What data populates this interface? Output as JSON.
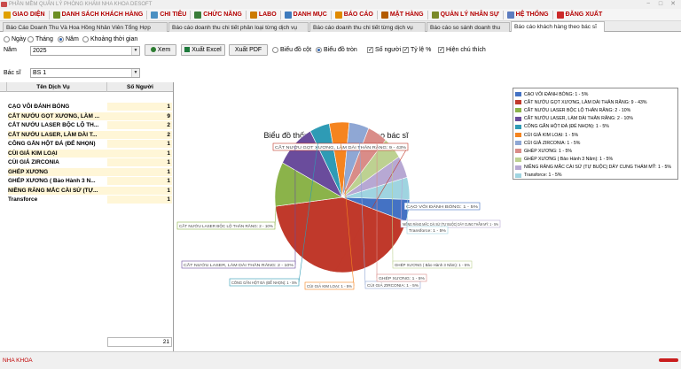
{
  "window": {
    "title": "PHẦN MỀM QUẢN LÝ PHÒNG KHÁM NHA KHOA DESOFT",
    "controls": [
      "−",
      "□",
      "✕"
    ]
  },
  "menu": [
    {
      "label": "GIAO DIỆN",
      "icon": "home-icon",
      "color": "#e0a000"
    },
    {
      "label": "DANH SÁCH KHÁCH HÀNG",
      "icon": "users-icon",
      "color": "#6b8e23"
    },
    {
      "label": "CHI TIÊU",
      "icon": "money-icon",
      "color": "#4a90c2"
    },
    {
      "label": "CHỨC NĂNG",
      "icon": "function-icon",
      "color": "#3a7d3a"
    },
    {
      "label": "LABO",
      "icon": "flask-icon",
      "color": "#cc7a00"
    },
    {
      "label": "DANH MỤC",
      "icon": "list-icon",
      "color": "#3e7bbd"
    },
    {
      "label": "BÁO CÁO",
      "icon": "report-icon",
      "color": "#e08a00"
    },
    {
      "label": "MẶT HÀNG",
      "icon": "box-icon",
      "color": "#b35c00"
    },
    {
      "label": "QUẢN LÝ NHÂN SỰ",
      "icon": "staff-icon",
      "color": "#7a8a2a"
    },
    {
      "label": "HỆ THỐNG",
      "icon": "system-icon",
      "color": "#5c7cbf"
    },
    {
      "label": "ĐĂNG XUẤT",
      "icon": "logout-icon",
      "color": "#cc2a2a"
    }
  ],
  "tabs": [
    {
      "label": "Báo Cáo Doanh Thu Và Hoa Hồng Nhân Viên Tổng Hợp",
      "active": false
    },
    {
      "label": "Báo cáo doanh thu chi tiết phân loại từng dịch vụ",
      "active": false
    },
    {
      "label": "Báo cáo doanh thu chi tiết từng dịch vụ",
      "active": false
    },
    {
      "label": "Báo cáo so sánh doanh thu",
      "active": false
    },
    {
      "label": "Báo cáo khách hàng theo bác sĩ",
      "active": true
    }
  ],
  "filters": {
    "period_options": [
      {
        "label": "Ngày",
        "selected": false
      },
      {
        "label": "Tháng",
        "selected": false
      },
      {
        "label": "Năm",
        "selected": true
      },
      {
        "label": "Khoảng thời gian",
        "selected": false
      }
    ],
    "year_label": "Năm",
    "year_value": "2025",
    "doctor_label": "Bác sĩ",
    "doctor_value": "BS 1",
    "view_button": "Xem",
    "export_excel": "Xuất Excel",
    "export_pdf": "Xuất PDF",
    "chart_types": [
      {
        "label": "Biểu đồ cột",
        "selected": false
      },
      {
        "label": "Biểu đồ tròn",
        "selected": true
      }
    ],
    "options": [
      {
        "label": "Số người",
        "checked": true
      },
      {
        "label": "Tỷ lệ %",
        "checked": true
      },
      {
        "label": "Hiện chú thích",
        "checked": true
      }
    ]
  },
  "grid": {
    "headers": [
      "Tên Dịch Vụ",
      "Số Người"
    ],
    "rows": [
      {
        "service": "CẠO VÔI ĐÁNH BÓNG",
        "count": "1"
      },
      {
        "service": "CẮT NƯỚU GỌT XƯƠNG, LÀM ...",
        "count": "9"
      },
      {
        "service": "CẮT NƯỚU LASER BỘC LỘ TH...",
        "count": "2"
      },
      {
        "service": "CẮT NƯỚU LASER, LÀM DÀI T...",
        "count": "2"
      },
      {
        "service": "CÔNG GẮN HỘT ĐÁ (ĐỂ NHỌN)",
        "count": "1"
      },
      {
        "service": "CÙI GIẢ KIM LOẠI",
        "count": "1"
      },
      {
        "service": "CÙI GIẢ ZIRCONIA",
        "count": "1"
      },
      {
        "service": "GHÉP XƯƠNG",
        "count": "1"
      },
      {
        "service": "GHÉP XƯƠNG ( Bảo Hành 3 N...",
        "count": "1"
      },
      {
        "service": "NIỀNG RĂNG MẮC CÀI SỨ (TỰ...",
        "count": "1"
      },
      {
        "service": "Transforce",
        "count": "1"
      }
    ],
    "total": "21"
  },
  "chart_data": {
    "type": "pie",
    "title": "Biểu đồ thống kê khách hàng theo bác sĩ",
    "slices": [
      {
        "label": "CẠO VÔI ĐÁNH BÓNG: 1 - 5%",
        "value": 1,
        "color": "#4472c4"
      },
      {
        "label": "CẮT NƯỚU GỌT XƯƠNG, LÀM DÀI THÂN RĂNG: 9 - 43%",
        "value": 9,
        "color": "#c0392b"
      },
      {
        "label": "CẮT NƯỚU LASER BỘC LỘ THÂN RĂNG: 2 - 10%",
        "value": 2,
        "color": "#8bb34a"
      },
      {
        "label": "CẮT NƯỚU LASER, LÀM DÀI THÂN RĂNG: 2 - 10%",
        "value": 2,
        "color": "#6a4c9c"
      },
      {
        "label": "CÔNG GẮN HỘT ĐÁ (ĐỂ NHỌN): 1 - 5%",
        "value": 1,
        "color": "#2e9bb5"
      },
      {
        "label": "CÙI GIẢ KIM LOẠI: 1 - 5%",
        "value": 1,
        "color": "#f5841f"
      },
      {
        "label": "CÙI GIẢ ZIRCONIA: 1 - 5%",
        "value": 1,
        "color": "#8fa7d4"
      },
      {
        "label": "GHÉP XƯƠNG: 1 - 5%",
        "value": 1,
        "color": "#d98c88"
      },
      {
        "label": "GHÉP XƯƠNG ( Bảo Hành 3 Năm): 1 - 5%",
        "value": 1,
        "color": "#bdd191"
      },
      {
        "label": "NIỀNG RĂNG MẮC CÀI SỨ (TỰ BUỘC) DÂY CUNG THẨM MỸ: 1 - 5%",
        "value": 1,
        "color": "#b7a8d3"
      },
      {
        "label": "Transforce: 1 - 5%",
        "value": 1,
        "color": "#9fd4e0"
      }
    ],
    "callouts": [
      "CẠO VÔI ĐÁNH BÓNG: 1 - 5%",
      "CẮT NƯỚU GỌT XƯƠNG, LÀM DÀI THÂN RĂNG: 9 - 43%",
      "CẮT NƯỚU LASER BỘC LỘ THÂN RĂNG: 2 - 10%",
      "CẮT NƯỚU LASER, LÀM DÀI THÂN RĂNG: 2 - 10%",
      "CÔNG GẮN HỘT ĐÁ (ĐỂ NHỌN): 1 - 5%",
      "CÙI GIẢ KIM LOẠI: 1 - 5%",
      "CÙI GIẢ ZIRCONIA: 1 - 5%",
      "GHÉP XƯƠNG: 1 - 5%",
      "GHÉP XƯƠNG ( Bảo Hành 3 Năm): 1 - 5%",
      "NIỀNG RĂNG MẮC CÀI SỨ (TỰ BUỘC) DÂY CUNG THẨM MỸ: 1 - 5%",
      "Transforce: 1 - 5%"
    ],
    "legend": [
      "CẠO VÔI ĐÁNH BÓNG: 1 - 5%",
      "CẮT NƯỚU GỌT XƯƠNG, LÀM DÀI THÂN RĂNG: 9 - 43%",
      "CẮT NƯỚU LASER BỘC LỘ THÂN RĂNG: 2 - 10%",
      "CẮT NƯỚU LASER, LÀM DÀI THÂN RĂNG: 2 - 10%",
      "CÔNG GẮN HỘT ĐÁ (ĐỂ NHỌN): 1 - 5%",
      "CÙI GIẢ KIM LOẠI: 1 - 5%",
      "CÙI GIẢ ZIRCONIA: 1 - 5%",
      "GHÉP XƯƠNG: 1 - 5%",
      "GHÉP XƯƠNG ( Bảo Hành 3 Năm): 1 - 5%",
      "NIỀNG RĂNG MẮC CÀI SỨ (TỰ BUỘC) DÂY CUNG THẨM MỸ: 1 - 5%",
      "Transforce: 1 - 5%"
    ],
    "legend_position": "top-right"
  },
  "status": {
    "left": "NHA KHOA"
  }
}
